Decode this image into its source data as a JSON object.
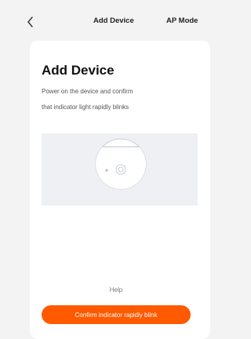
{
  "header": {
    "tabs": [
      {
        "label": "Add Device"
      },
      {
        "label": "AP Mode"
      }
    ]
  },
  "main": {
    "title": "Add Device",
    "description_lines": [
      "Power on the device and confirm",
      "that indicator light rapidly blinks"
    ],
    "help_label": "Help",
    "confirm_label": "Confirm indicator rapidly blink"
  },
  "colors": {
    "accent": "#ff5a00",
    "background": "#f3f3f3",
    "card": "#ffffff",
    "illustration_bg": "#eef0f3"
  },
  "icons": {
    "back": "chevron-left-icon",
    "illustration": "device-indicator-illustration"
  }
}
